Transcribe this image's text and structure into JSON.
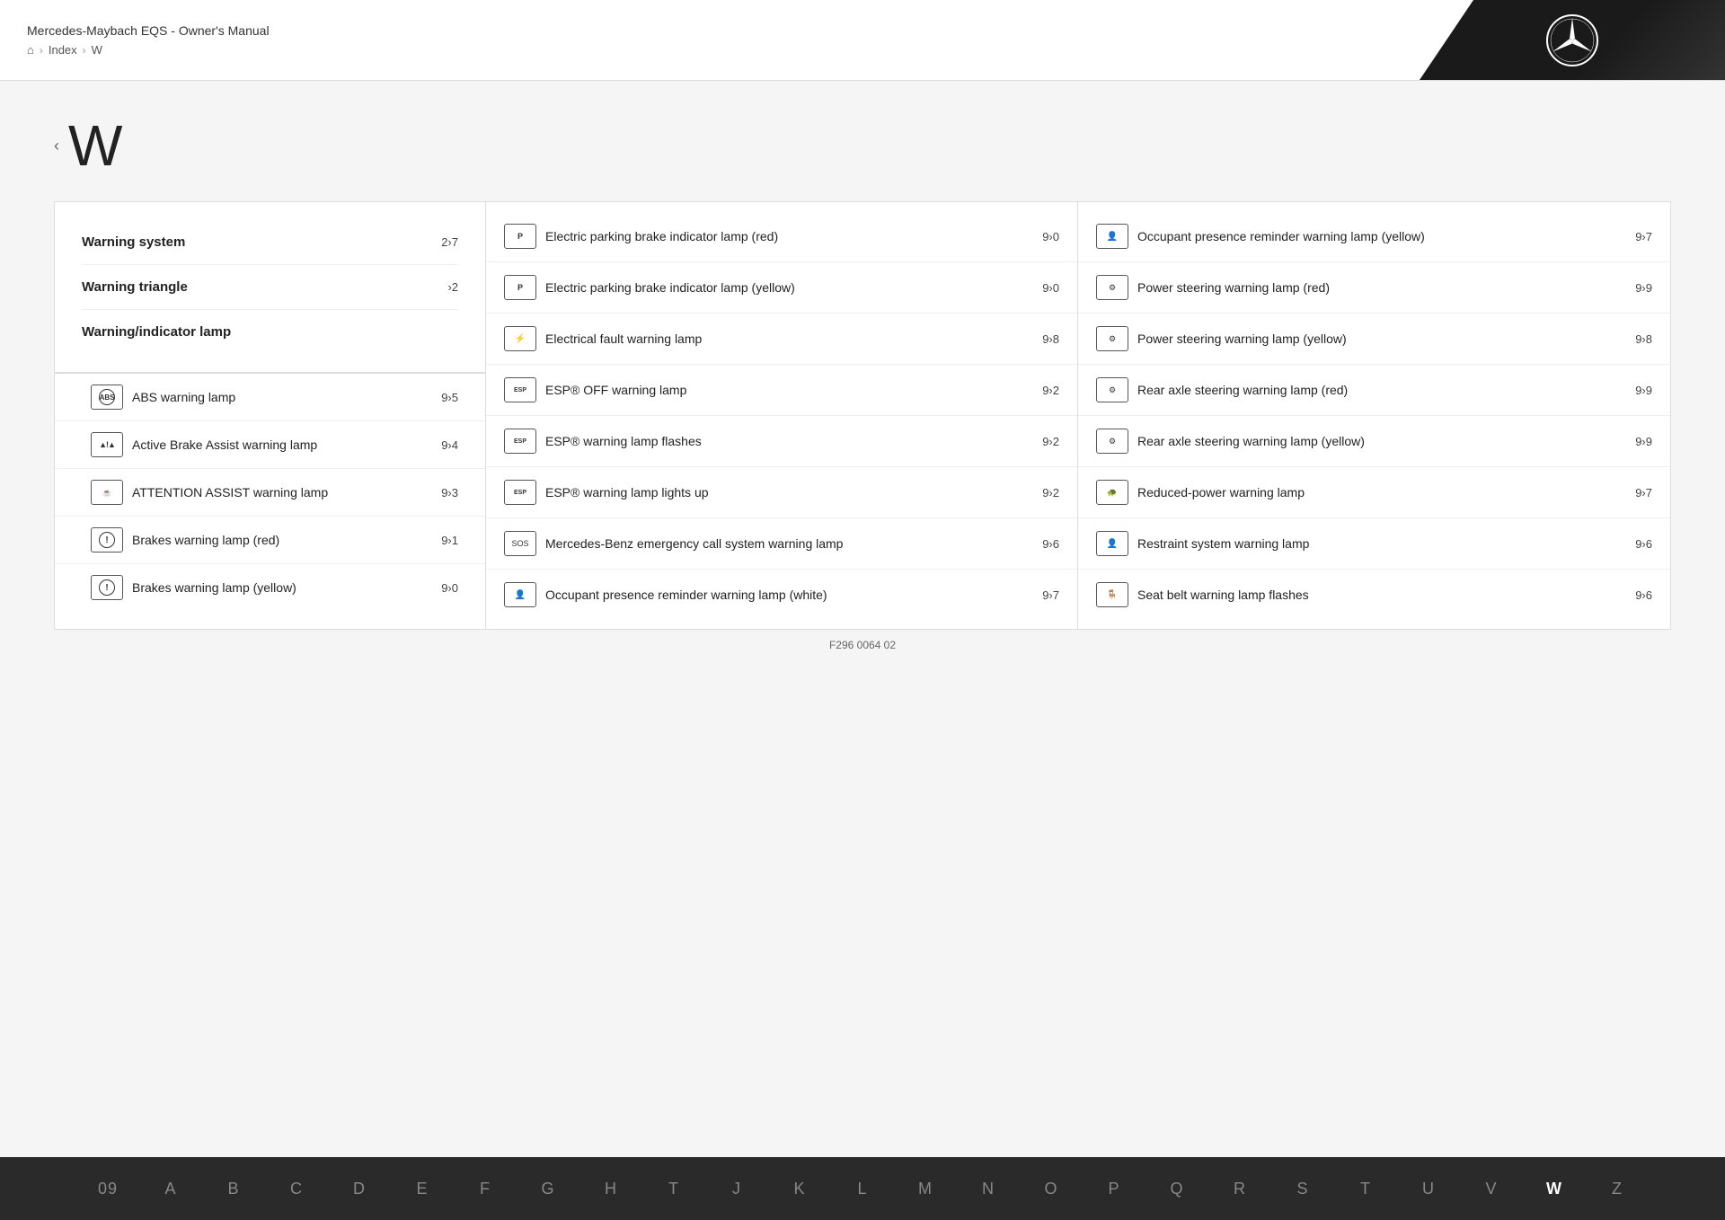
{
  "header": {
    "title": "Mercedes-Maybach EQS - Owner's Manual",
    "breadcrumb": {
      "home": "⌂",
      "items": [
        "Index",
        "W"
      ]
    }
  },
  "page": {
    "letter": "W",
    "nav_arrow": "‹"
  },
  "left_column": {
    "top_items": [
      {
        "label": "Warning system",
        "page": "2›7"
      },
      {
        "label": "Warning triangle",
        "page": "›2"
      },
      {
        "label": "Warning/indicator lamp",
        "page": ""
      }
    ],
    "sub_items": [
      {
        "label": "ABS warning lamp",
        "page": "9›5",
        "icon_type": "abs"
      },
      {
        "label": "Active Brake Assist warning lamp",
        "page": "9›4",
        "icon_type": "brake_assist"
      },
      {
        "label": "ATTENTION ASSIST warning lamp",
        "page": "9›3",
        "icon_type": "attention"
      },
      {
        "label": "Brakes warning lamp (red)",
        "page": "9›1",
        "icon_type": "brake_red"
      },
      {
        "label": "Brakes warning lamp (yellow)",
        "page": "9›0",
        "icon_type": "brake_yellow"
      }
    ]
  },
  "middle_column": {
    "items": [
      {
        "label": "Electric parking brake indicator lamp (red)",
        "page": "9›0",
        "icon_type": "epb"
      },
      {
        "label": "Electric parking brake indicator lamp (yellow)",
        "page": "9›0",
        "icon_type": "epb"
      },
      {
        "label": "Electrical fault warning lamp",
        "page": "9›8",
        "icon_type": "elec_fault"
      },
      {
        "label": "ESP® OFF warning lamp",
        "page": "9›2",
        "icon_type": "esp_off"
      },
      {
        "label": "ESP® warning lamp flashes",
        "page": "9›2",
        "icon_type": "esp_flash"
      },
      {
        "label": "ESP® warning lamp lights up",
        "page": "9›2",
        "icon_type": "esp_lights"
      },
      {
        "label": "Mercedes-Benz emergency call system warning lamp",
        "page": "9›6",
        "icon_type": "emergency"
      },
      {
        "label": "Occupant presence reminder warning lamp (white)",
        "page": "9›7",
        "icon_type": "occupant"
      }
    ]
  },
  "right_column": {
    "items": [
      {
        "label": "Occupant presence reminder warning lamp (yellow)",
        "page": "9›7",
        "icon_type": "occupant"
      },
      {
        "label": "Power steering warning lamp (red)",
        "page": "9›9",
        "icon_type": "steering"
      },
      {
        "label": "Power steering warning lamp (yellow)",
        "page": "9›8",
        "icon_type": "steering"
      },
      {
        "label": "Rear axle steering warning lamp (red)",
        "page": "9›9",
        "icon_type": "rear_steer"
      },
      {
        "label": "Rear axle steering warning lamp (yellow)",
        "page": "9›9",
        "icon_type": "rear_steer"
      },
      {
        "label": "Reduced-power warning lamp",
        "page": "9›7",
        "icon_type": "reduced_power"
      },
      {
        "label": "Restraint system warning lamp",
        "page": "9›6",
        "icon_type": "restraint"
      },
      {
        "label": "Seat belt warning lamp flashes",
        "page": "9›6",
        "icon_type": "seatbelt"
      }
    ]
  },
  "footer": {
    "alphabet": [
      "09",
      "A",
      "B",
      "C",
      "D",
      "E",
      "F",
      "G",
      "H",
      "T",
      "J",
      "K",
      "L",
      "M",
      "N",
      "O",
      "P",
      "Q",
      "R",
      "S",
      "T",
      "U",
      "V",
      "W",
      "Z"
    ],
    "active_letter": "W",
    "doc_id": "F296 0064 02"
  }
}
